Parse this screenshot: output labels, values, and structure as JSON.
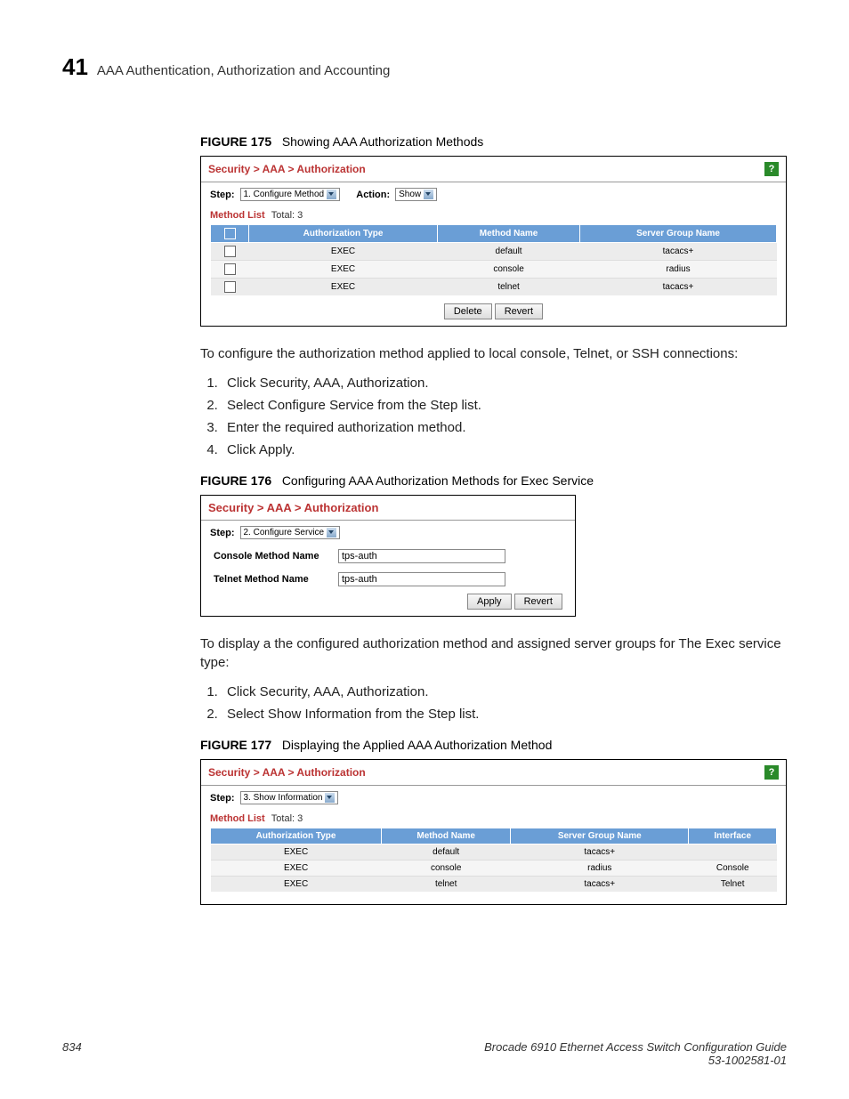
{
  "header": {
    "chapter_num": "41",
    "chapter_title": "AAA Authentication, Authorization and Accounting"
  },
  "fig175": {
    "num": "FIGURE 175",
    "title": "Showing AAA Authorization Methods",
    "breadcrumb": "Security > AAA > Authorization",
    "step_label": "Step:",
    "step_value": "1. Configure Method",
    "action_label": "Action:",
    "action_value": "Show",
    "method_list_label": "Method List",
    "method_list_total": "Total: 3",
    "cols": {
      "c1": "Authorization Type",
      "c2": "Method Name",
      "c3": "Server Group Name"
    },
    "rows": [
      {
        "type": "EXEC",
        "method": "default",
        "server": "tacacs+"
      },
      {
        "type": "EXEC",
        "method": "console",
        "server": "radius"
      },
      {
        "type": "EXEC",
        "method": "telnet",
        "server": "tacacs+"
      }
    ],
    "buttons": {
      "delete": "Delete",
      "revert": "Revert"
    }
  },
  "para1": "To configure the authorization method applied to local console, Telnet, or SSH connections:",
  "steps1": [
    "Click Security, AAA, Authorization.",
    "Select Configure Service from the Step list.",
    "Enter the required authorization method.",
    "Click Apply."
  ],
  "fig176": {
    "num": "FIGURE 176",
    "title": "Configuring AAA Authorization Methods for Exec Service",
    "breadcrumb": "Security > AAA > Authorization",
    "step_label": "Step:",
    "step_value": "2. Configure Service",
    "console_label": "Console Method Name",
    "console_value": "tps-auth",
    "telnet_label": "Telnet Method Name",
    "telnet_value": "tps-auth",
    "buttons": {
      "apply": "Apply",
      "revert": "Revert"
    }
  },
  "para2": "To display a the configured authorization method and assigned server groups for The Exec service type:",
  "steps2": [
    "Click Security, AAA, Authorization.",
    "Select Show Information from the Step list."
  ],
  "fig177": {
    "num": "FIGURE 177",
    "title": "Displaying the Applied AAA Authorization Method",
    "breadcrumb": "Security > AAA > Authorization",
    "step_label": "Step:",
    "step_value": "3. Show Information",
    "method_list_label": "Method List",
    "method_list_total": "Total: 3",
    "cols": {
      "c1": "Authorization Type",
      "c2": "Method Name",
      "c3": "Server Group Name",
      "c4": "Interface"
    },
    "rows": [
      {
        "type": "EXEC",
        "method": "default",
        "server": "tacacs+",
        "iface": ""
      },
      {
        "type": "EXEC",
        "method": "console",
        "server": "radius",
        "iface": "Console"
      },
      {
        "type": "EXEC",
        "method": "telnet",
        "server": "tacacs+",
        "iface": "Telnet"
      }
    ]
  },
  "footer": {
    "page": "834",
    "line1": "Brocade 6910 Ethernet Access Switch Configuration Guide",
    "line2": "53-1002581-01"
  }
}
